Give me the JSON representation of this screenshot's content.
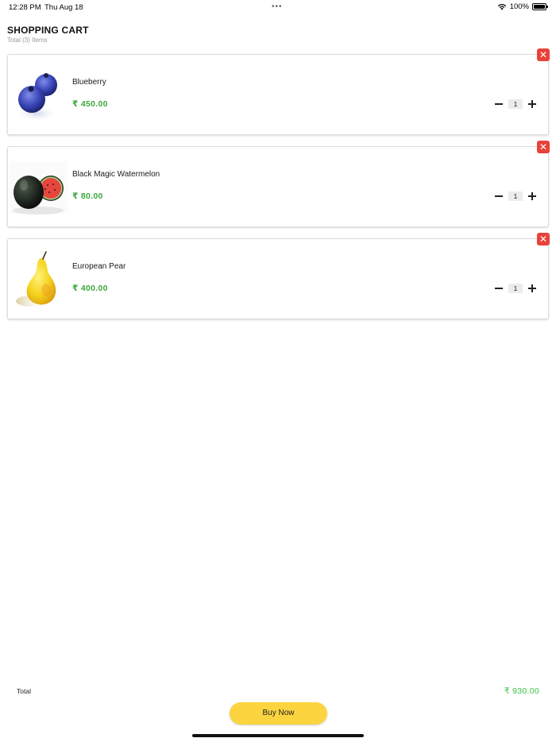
{
  "status_bar": {
    "time": "12:28 PM",
    "date": "Thu Aug 18",
    "dots": "•••",
    "battery": "100%",
    "icons": [
      "wifi-icon",
      "battery-icon"
    ]
  },
  "header": {
    "title": "SHOPPING CART",
    "subtitle": "Total (3) Items"
  },
  "cart": {
    "items": [
      {
        "name": "Blueberry",
        "price": "₹ 450.00",
        "quantity": "1",
        "remove_icon": "✕",
        "image": "blueberry"
      },
      {
        "name": "Black Magic Watermelon",
        "price": "₹ 80.00",
        "quantity": "1",
        "remove_icon": "✕",
        "image": "watermelon"
      },
      {
        "name": "European Pear",
        "price": "₹ 400.00",
        "quantity": "1",
        "remove_icon": "✕",
        "image": "pear"
      }
    ]
  },
  "footer": {
    "total_label": "Total",
    "total_value": "₹ 930.00",
    "buy_button": "Buy Now"
  },
  "colors": {
    "price_green": "#3ca83c",
    "total_green": "#3cc04a",
    "remove_red": "#e8423a",
    "buy_yellow": "#fcd43f"
  }
}
